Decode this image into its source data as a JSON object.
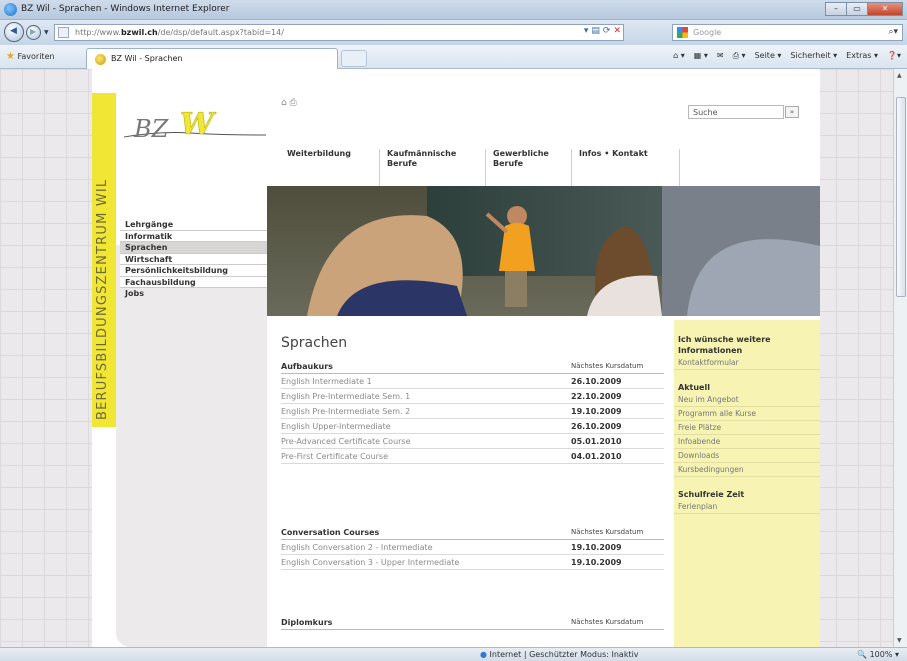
{
  "window": {
    "title": "BZ Wil - Sprachen - Windows Internet Explorer",
    "controls": [
      "–",
      "▭",
      "✕"
    ]
  },
  "address_bar": {
    "url_prefix": "http://www.",
    "url_host": "bzwil.ch",
    "url_path": "/de/dsp/default.aspx?tabid=14/"
  },
  "search_bar": {
    "placeholder": "Google"
  },
  "favorites_bar": {
    "favorites_label": "Favoriten",
    "tab_label": "BZ Wil - Sprachen",
    "commands": [
      "Seite ▾",
      "Sicherheit ▾",
      "Extras ▾"
    ]
  },
  "site": {
    "logo_text": "BZW",
    "vertical_brand": "BERUFSBILDUNGSZENTRUM WIL",
    "brand_color": "#f2e635",
    "left_nav": [
      {
        "label": "Lehrgänge",
        "active": false
      },
      {
        "label": "Informatik",
        "active": false
      },
      {
        "label": "Sprachen",
        "active": true
      },
      {
        "label": "Wirtschaft",
        "active": false
      },
      {
        "label": "Persönlichkeitsbildung",
        "active": false
      },
      {
        "label": "Fachausbildung",
        "active": false
      },
      {
        "label": "Jobs",
        "active": false
      }
    ],
    "search_value": "Suche",
    "search_button": "»",
    "main_nav": [
      {
        "label": "Weiterbildung"
      },
      {
        "label": "Kaufmännische Berufe"
      },
      {
        "label": "Gewerbliche Berufe"
      },
      {
        "label": "Infos • Kontakt"
      }
    ],
    "page_title": "Sprachen",
    "sections": [
      {
        "title": "Aufbaukurs",
        "date_header": "Nächstes Kursdatum",
        "rows": [
          {
            "course": "English Intermediate 1",
            "date": "26.10.2009"
          },
          {
            "course": "English Pre-Intermediate Sem. 1",
            "date": "22.10.2009"
          },
          {
            "course": "English Pre-Intermediate Sem. 2",
            "date": "19.10.2009"
          },
          {
            "course": "English Upper-Intermediate",
            "date": "26.10.2009"
          },
          {
            "course": "Pre-Advanced Certificate Course",
            "date": "05.01.2010"
          },
          {
            "course": "Pre-First Certificate Course",
            "date": "04.01.2010"
          }
        ]
      },
      {
        "title": "Conversation Courses",
        "date_header": "Nächstes Kursdatum",
        "rows": [
          {
            "course": "English Conversation 2 - Intermediate",
            "date": "19.10.2009"
          },
          {
            "course": "English Conversation 3 - Upper Intermediate",
            "date": "19.10.2009"
          }
        ]
      },
      {
        "title": "Diplomkurs",
        "date_header": "Nächstes Kursdatum",
        "rows": []
      }
    ],
    "sidebar": {
      "info_heading": "Ich wünsche weitere Informationen",
      "info_links": [
        "Kontaktformular"
      ],
      "aktuell_heading": "Aktuell",
      "aktuell_links": [
        "Neu im Angebot",
        "Programm alle Kurse",
        "Freie Plätze",
        "Infoabende",
        "Downloads",
        "Kursbedingungen"
      ],
      "schulfrei_heading": "Schulfreie Zeit",
      "schulfrei_links": [
        "Ferienplan"
      ]
    }
  },
  "status_bar": {
    "zone": "Internet | Geschützter Modus: Inaktiv",
    "zoom": "100%"
  }
}
